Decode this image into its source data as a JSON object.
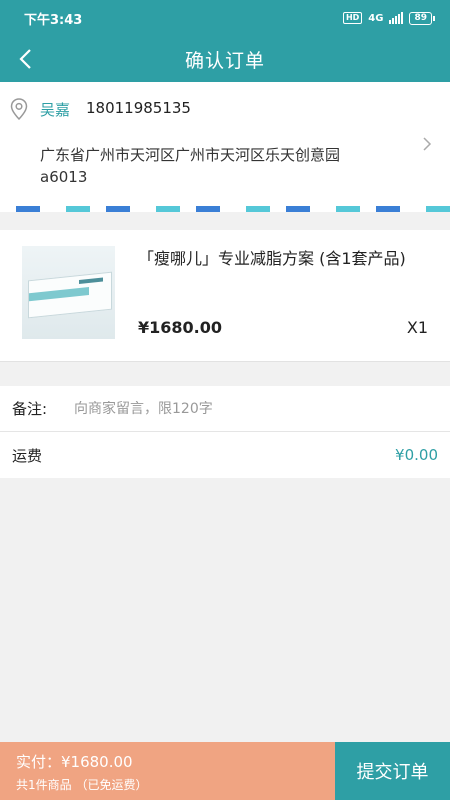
{
  "status_bar": {
    "time": "下午3:43",
    "hd_label": "HD",
    "network": "4G",
    "battery": "89"
  },
  "nav": {
    "title": "确认订单"
  },
  "address": {
    "name": "吴嘉",
    "phone": "18011985135",
    "detail": "广东省广州市天河区广州市天河区乐天创意园a6013"
  },
  "product": {
    "title": "「瘦哪儿」专业减脂方案 (含1套产品)",
    "price": "¥1680.00",
    "quantity": "X1"
  },
  "remark": {
    "label": "备注:",
    "placeholder": "向商家留言，限120字"
  },
  "shipping": {
    "label": "运费",
    "value": "¥0.00"
  },
  "footer": {
    "total": "实付：¥1680.00",
    "count": "共1件商品 （已免运费）",
    "submit_label": "提交订单"
  },
  "colors": {
    "accent": "#2e9fa5",
    "footer_summary": "#f0a482"
  }
}
